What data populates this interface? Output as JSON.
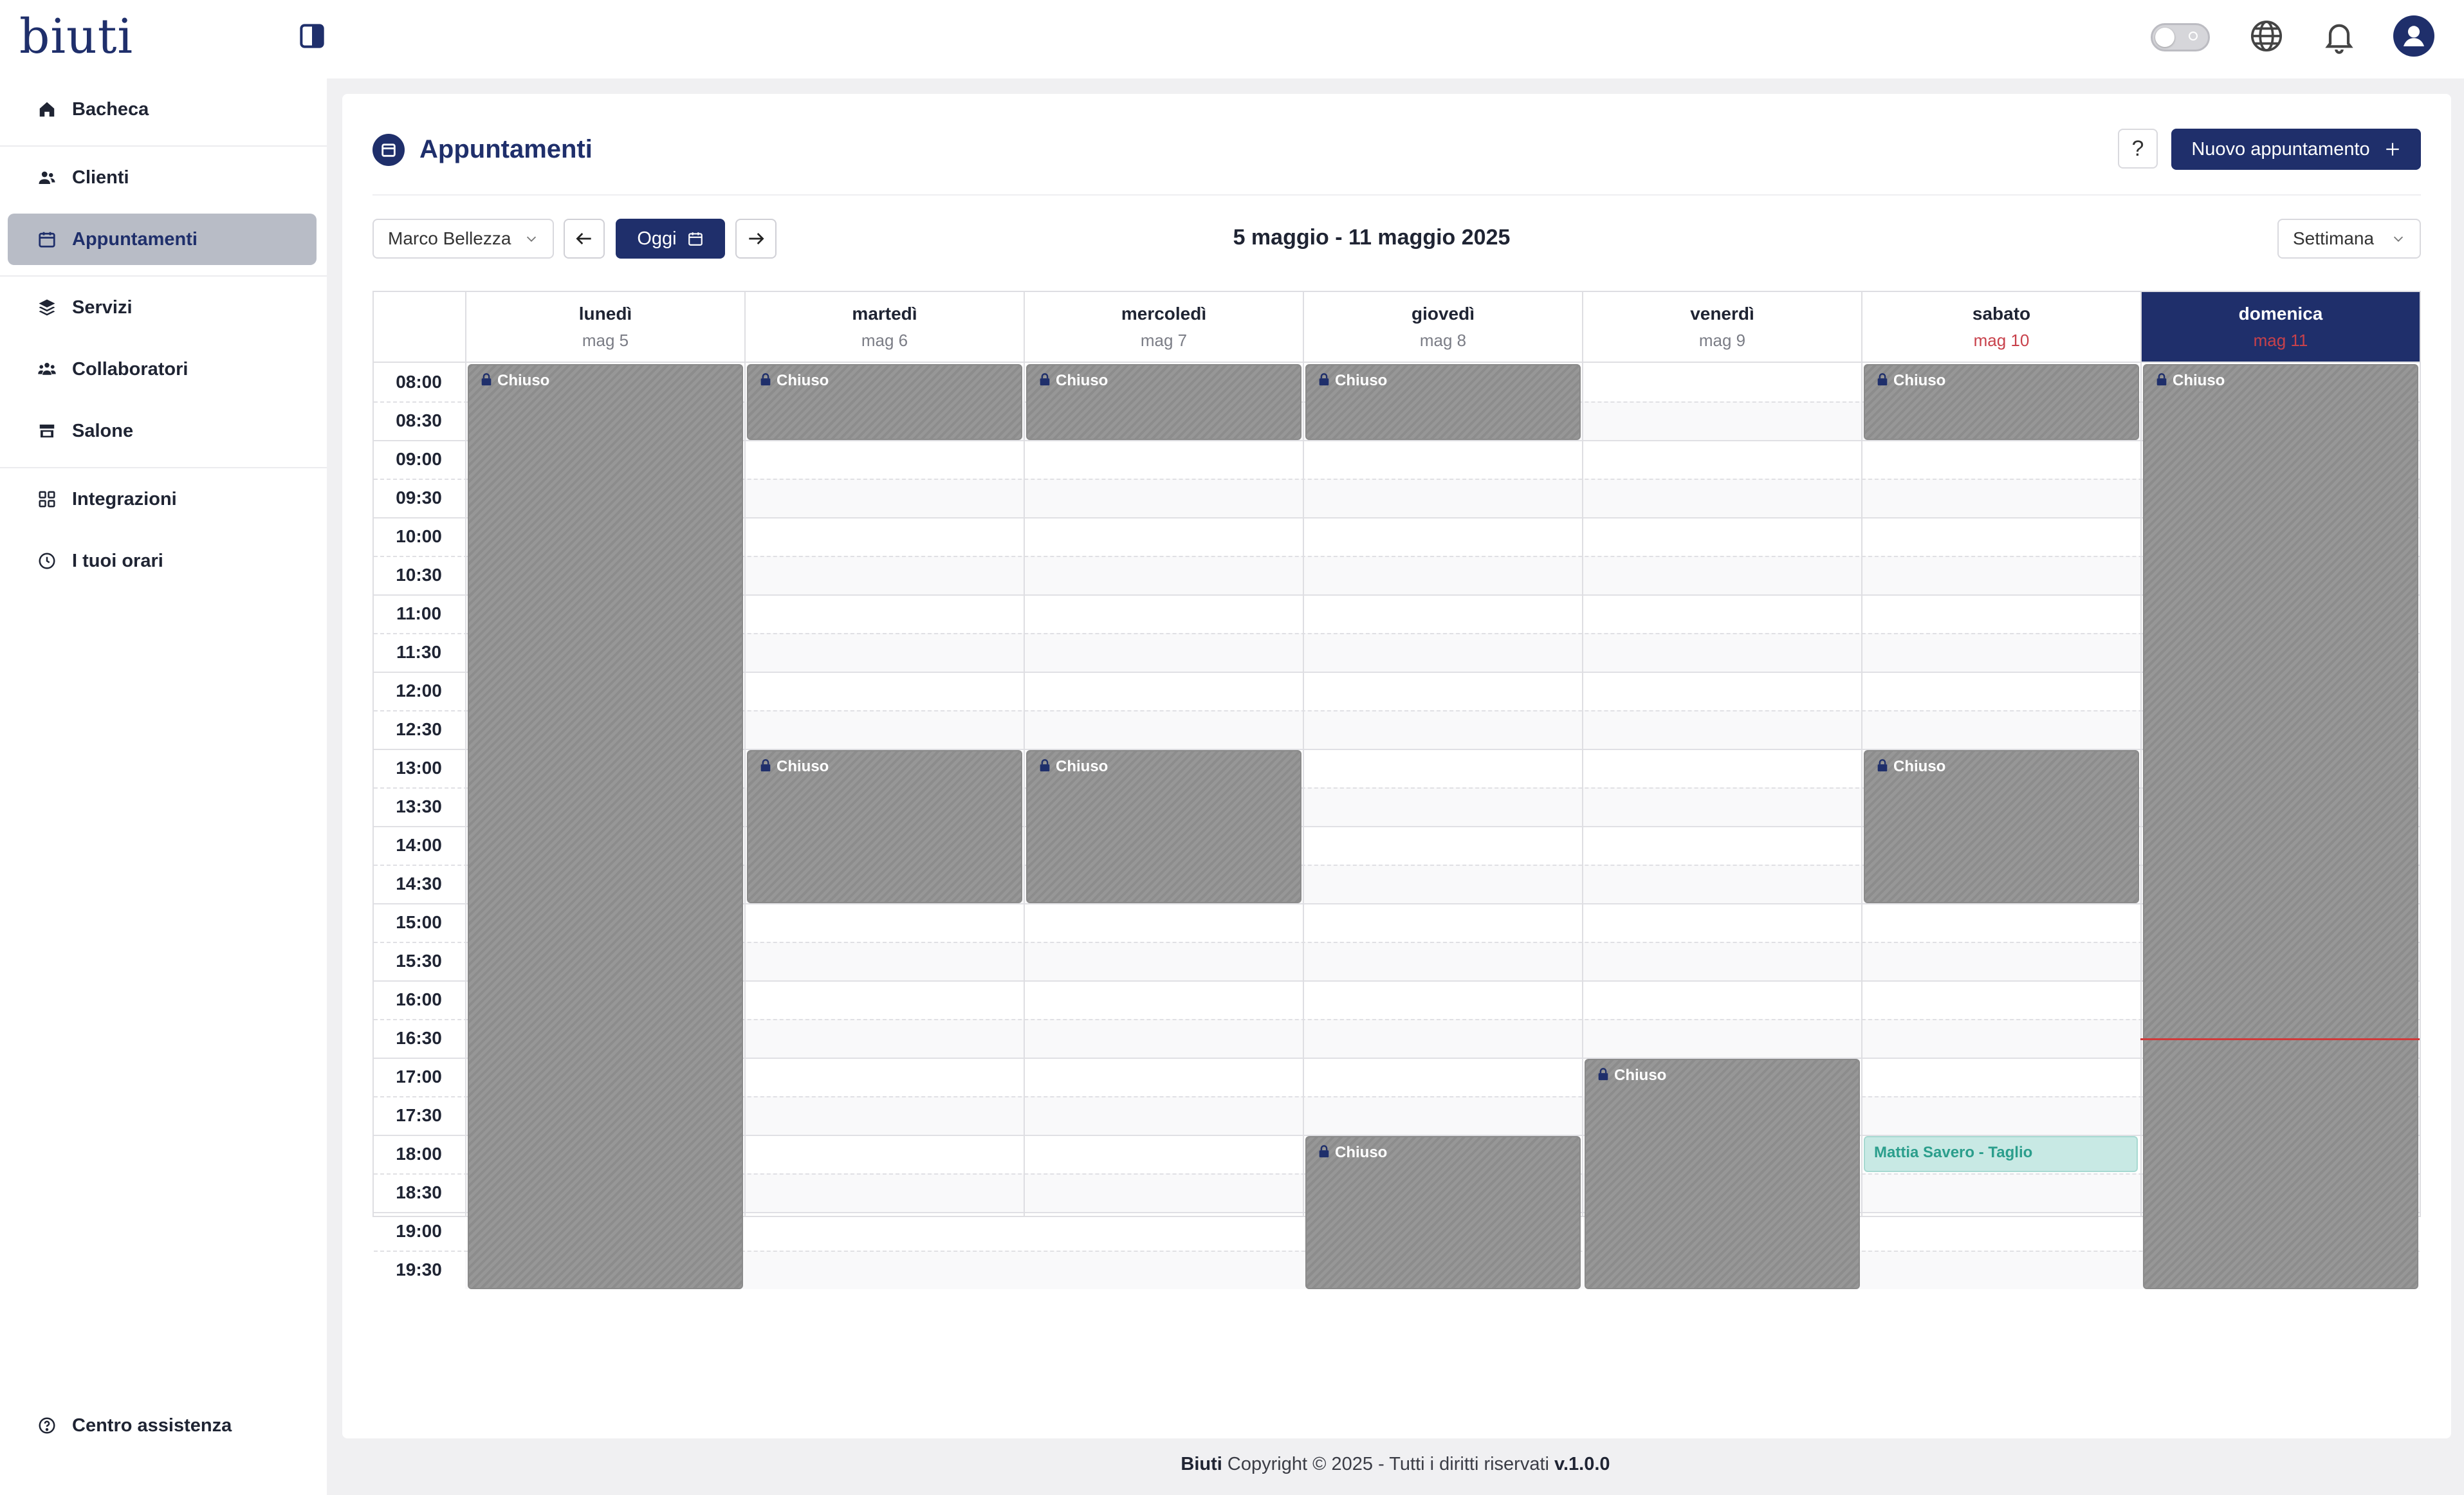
{
  "app": {
    "logo": "biuti"
  },
  "sidebar": {
    "items": [
      {
        "label": "Bacheca",
        "icon": "home-icon"
      },
      {
        "label": "Clienti",
        "icon": "users-icon"
      },
      {
        "label": "Appuntamenti",
        "icon": "calendar-icon",
        "active": true
      },
      {
        "label": "Servizi",
        "icon": "layers-icon"
      },
      {
        "label": "Collaboratori",
        "icon": "team-icon"
      },
      {
        "label": "Salone",
        "icon": "store-icon"
      },
      {
        "label": "Integrazioni",
        "icon": "grid-icon"
      },
      {
        "label": "I tuoi orari",
        "icon": "clock-icon"
      }
    ],
    "help": {
      "label": "Centro assistenza",
      "icon": "help-circle-icon"
    }
  },
  "page": {
    "title": "Appuntamenti",
    "help_label": "?",
    "new_label": "Nuovo appuntamento",
    "staff_select": "Marco Bellezza",
    "today_label": "Oggi",
    "range_label": "5 maggio - 11 maggio 2025",
    "view_select": "Settimana"
  },
  "calendar": {
    "times": [
      "08:00",
      "08:30",
      "09:00",
      "09:30",
      "10:00",
      "10:30",
      "11:00",
      "11:30",
      "12:00",
      "12:30",
      "13:00",
      "13:30",
      "14:00",
      "14:30",
      "15:00",
      "15:30",
      "16:00",
      "16:30",
      "17:00",
      "17:30",
      "18:00",
      "18:30",
      "19:00",
      "19:30"
    ],
    "days": [
      {
        "name": "lunedì",
        "date": "mag 5"
      },
      {
        "name": "martedì",
        "date": "mag 6"
      },
      {
        "name": "mercoledì",
        "date": "mag 7"
      },
      {
        "name": "giovedì",
        "date": "mag 8"
      },
      {
        "name": "venerdì",
        "date": "mag 9"
      },
      {
        "name": "sabato",
        "date": "mag 10",
        "weekend": true
      },
      {
        "name": "domenica",
        "date": "mag 11",
        "today": true
      }
    ],
    "closed_label": "Chiuso",
    "blocks": [
      {
        "day": 0,
        "start": "08:00",
        "end": "20:00"
      },
      {
        "day": 1,
        "start": "08:00",
        "end": "09:00"
      },
      {
        "day": 1,
        "start": "13:00",
        "end": "15:00"
      },
      {
        "day": 2,
        "start": "08:00",
        "end": "09:00"
      },
      {
        "day": 2,
        "start": "13:00",
        "end": "15:00"
      },
      {
        "day": 3,
        "start": "08:00",
        "end": "09:00"
      },
      {
        "day": 3,
        "start": "18:00",
        "end": "20:00"
      },
      {
        "day": 4,
        "start": "17:00",
        "end": "20:00"
      },
      {
        "day": 5,
        "start": "08:00",
        "end": "09:00"
      },
      {
        "day": 5,
        "start": "13:00",
        "end": "15:00"
      },
      {
        "day": 6,
        "start": "08:00",
        "end": "20:00"
      }
    ],
    "appointments": [
      {
        "day": 5,
        "start": "18:00",
        "end": "18:30",
        "label": "Mattia Savero - Taglio"
      }
    ],
    "now": {
      "day": 6,
      "time": "16:45"
    }
  },
  "footer": {
    "brand": "Biuti",
    "text": " Copyright © 2025 - Tutti i diritti riservati ",
    "version": "v.1.0.0"
  }
}
